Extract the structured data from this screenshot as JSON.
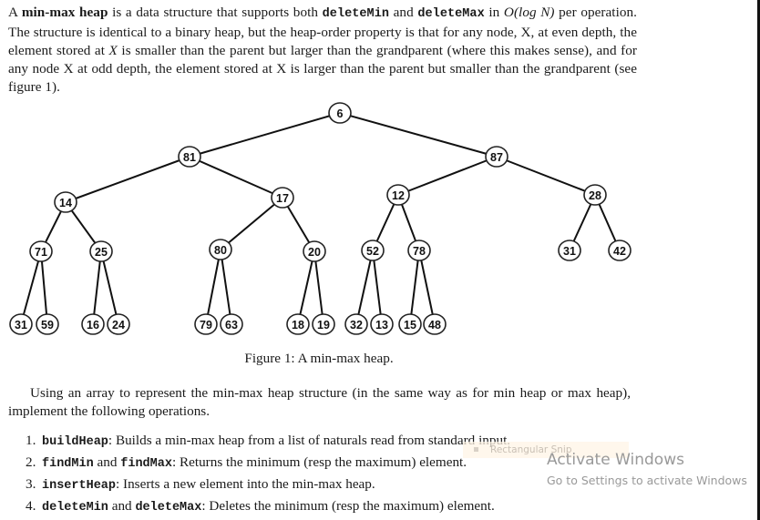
{
  "document": {
    "intro": {
      "lead": "A ",
      "term": "min-max heap",
      "part1": " is a data structure that supports both ",
      "op1": "deleteMin",
      "and1": " and ",
      "op2": "deleteMax",
      "part2": " in ",
      "complexity": "O(log N)",
      "part3": " per operation. The structure is identical to a binary heap, but the heap-order property is that for any node, X, at even depth, the element stored at ",
      "x_italic": "X",
      "part4": " is smaller than the parent but larger than the grandparent (where this makes sense), and for any node X at odd depth, the element stored at X is larger than the parent but smaller than the grandparent (see figure 1)."
    },
    "figure": {
      "caption": "Figure 1: A min-max heap.",
      "tree": {
        "root": "6",
        "level1": [
          "81",
          "87"
        ],
        "level2": [
          "14",
          "17",
          "12",
          "28"
        ],
        "level3": [
          "71",
          "25",
          "80",
          "20",
          "52",
          "78",
          "31",
          "42"
        ],
        "level4": [
          "31",
          "59",
          "16",
          "24",
          "79",
          "63",
          "18",
          "19",
          "32",
          "13",
          "15",
          "48"
        ]
      }
    },
    "paragraph2": "Using an array to represent the min-max heap structure (in the same way as for min heap or max heap), implement the following operations.",
    "operations": [
      {
        "num": "1.",
        "names": [
          "buildHeap"
        ],
        "joiner": "",
        "desc": ": Builds a min-max heap from a list of naturals read from standard input."
      },
      {
        "num": "2.",
        "names": [
          "findMin",
          "findMax"
        ],
        "joiner": " and ",
        "desc": ": Returns the minimum (resp the maximum) element."
      },
      {
        "num": "3.",
        "names": [
          "insertHeap"
        ],
        "joiner": "",
        "desc": ": Inserts a new element into the min-max heap."
      },
      {
        "num": "4.",
        "names": [
          "deleteMin",
          "deleteMax"
        ],
        "joiner": " and ",
        "desc": ": Deletes the minimum (resp the maximum) element."
      }
    ]
  },
  "overlays": {
    "snip_tooltip": "Rectangular Snip",
    "activation_title": "Activate Windows",
    "activation_subtitle": "Go to Settings to activate Windows"
  }
}
